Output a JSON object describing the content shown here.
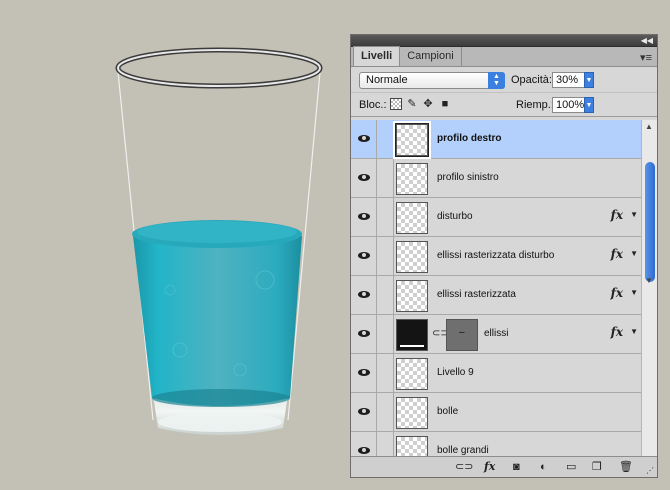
{
  "panel": {
    "tabs": [
      {
        "label": "Livelli",
        "active": true
      },
      {
        "label": "Campioni",
        "active": false
      }
    ],
    "blend_mode": "Normale",
    "opacity_label": "Opacità:",
    "opacity_value": "30%",
    "lock_label": "Bloc.:",
    "fill_label": "Riemp.:",
    "fill_value": "100%"
  },
  "layers": [
    {
      "name": "profilo destro",
      "selected": true,
      "fx": false
    },
    {
      "name": "profilo sinistro",
      "selected": false,
      "fx": false
    },
    {
      "name": "disturbo",
      "selected": false,
      "fx": true
    },
    {
      "name": "ellissi rasterizzata disturbo",
      "selected": false,
      "fx": true
    },
    {
      "name": "ellissi rasterizzata",
      "selected": false,
      "fx": true
    },
    {
      "name": "ellissi",
      "selected": false,
      "fx": true,
      "mask": true
    },
    {
      "name": "Livello 9",
      "selected": false,
      "fx": false
    },
    {
      "name": "bolle",
      "selected": false,
      "fx": false
    },
    {
      "name": "bolle grandi",
      "selected": false,
      "fx": false
    }
  ],
  "fx_label": "fx",
  "colors": {
    "background": "#c3c1b5",
    "selection": "#b3d0fc",
    "water": "#2ab3c6"
  }
}
